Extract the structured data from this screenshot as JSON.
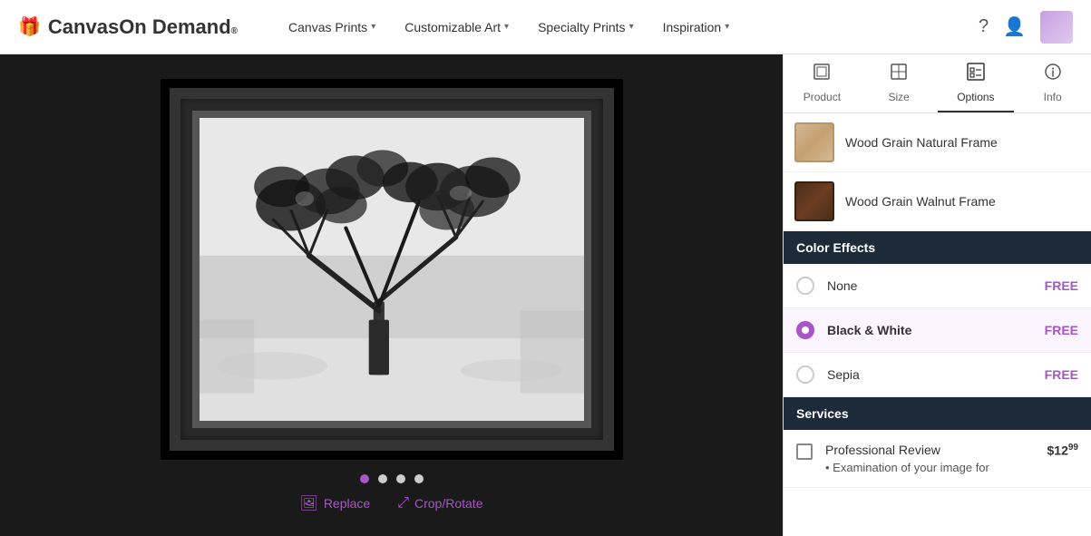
{
  "logo": {
    "icon": "🎁",
    "canvas": "Canvas",
    "ondemand": "On Demand",
    "trademark": "®"
  },
  "nav": {
    "items": [
      {
        "label": "Canvas Prints",
        "has_dropdown": true
      },
      {
        "label": "Customizable Art",
        "has_dropdown": true
      },
      {
        "label": "Specialty Prints",
        "has_dropdown": true
      },
      {
        "label": "Inspiration",
        "has_dropdown": true
      }
    ]
  },
  "tabs": [
    {
      "label": "Product",
      "icon": "product"
    },
    {
      "label": "Size",
      "icon": "size"
    },
    {
      "label": "Options",
      "icon": "options",
      "active": true
    },
    {
      "label": "Info",
      "icon": "info"
    }
  ],
  "frames": [
    {
      "label": "Wood Grain Natural Frame",
      "style": "natural"
    },
    {
      "label": "Wood Grain Walnut Frame",
      "style": "walnut"
    }
  ],
  "color_effects": {
    "section_header": "Color Effects",
    "options": [
      {
        "label": "None",
        "price_label": "FREE",
        "selected": false
      },
      {
        "label": "Black & White",
        "price_label": "FREE",
        "selected": true
      },
      {
        "label": "Sepia",
        "price_label": "FREE",
        "selected": false
      }
    ]
  },
  "services": {
    "section_header": "Services",
    "items": [
      {
        "name": "Professional Review",
        "price": "$12",
        "price_cents": "99",
        "description": "Examination of your image for",
        "checked": false
      }
    ]
  },
  "image_controls": {
    "replace_label": "Replace",
    "crop_rotate_label": "Crop/Rotate"
  },
  "dots": [
    {
      "active": true
    },
    {
      "active": false
    },
    {
      "active": false
    },
    {
      "active": false
    }
  ]
}
